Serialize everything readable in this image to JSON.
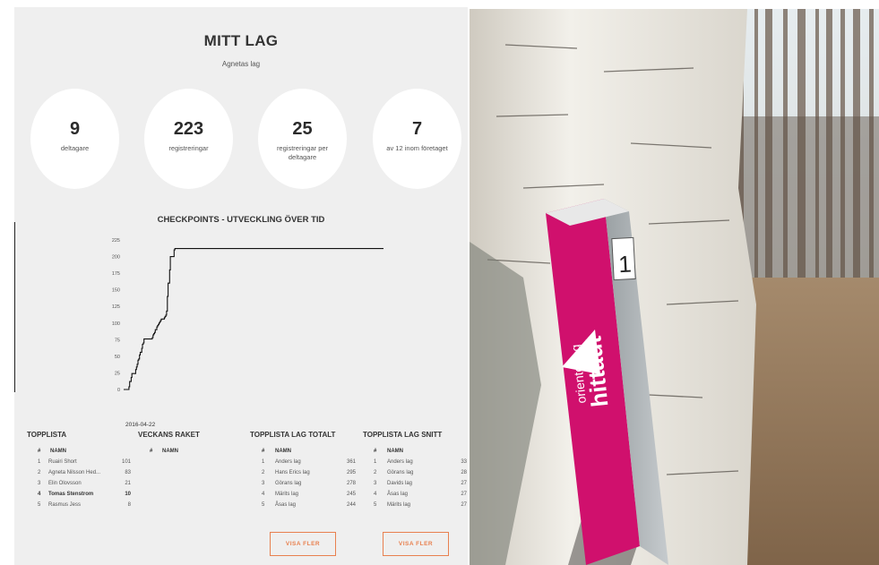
{
  "header": {
    "title": "MITT LAG",
    "subtitle": "Agnetas lag"
  },
  "stats": [
    {
      "value": "9",
      "label": "deltagare"
    },
    {
      "value": "223",
      "label": "registreringar"
    },
    {
      "value": "25",
      "label": "registreringar per deltagare"
    },
    {
      "value": "7",
      "label": "av 12 inom företaget"
    }
  ],
  "chart_data": {
    "type": "line",
    "title": "CHECKPOINTS - UTVECKLING ÖVER TID",
    "ylim": [
      0,
      225
    ],
    "yticks": [
      0,
      25,
      50,
      75,
      100,
      125,
      150,
      175,
      200,
      225
    ],
    "x_label_first": "2016-04-22",
    "values": [
      0,
      0,
      0,
      0,
      0,
      0,
      0,
      4,
      12,
      12,
      18,
      24,
      24,
      24,
      24,
      24,
      30,
      34,
      38,
      44,
      46,
      52,
      56,
      56,
      62,
      68,
      70,
      76,
      76,
      76,
      76,
      76,
      76,
      76,
      76,
      76,
      76,
      76,
      78,
      82,
      84,
      86,
      90,
      90,
      94,
      96,
      98,
      100,
      102,
      104,
      106,
      106,
      106,
      106,
      108,
      110,
      112,
      118,
      140,
      160,
      160,
      180,
      200,
      200,
      200,
      200,
      200,
      210,
      212,
      212,
      212,
      212,
      212,
      212,
      212,
      212,
      212,
      212,
      212,
      212,
      212,
      212,
      212,
      212,
      212,
      212,
      212,
      212,
      212,
      212,
      212,
      212,
      212,
      212,
      212,
      212,
      212,
      212,
      212,
      212,
      212,
      212,
      212,
      212,
      212,
      212,
      212,
      212,
      212,
      212,
      212,
      212,
      212,
      212,
      212,
      212,
      212,
      212,
      212,
      212,
      212,
      212,
      212,
      212,
      212,
      212,
      212,
      212,
      212,
      212,
      212,
      212,
      212,
      212,
      212,
      212,
      212,
      212,
      212,
      212,
      212,
      212,
      212,
      212,
      212,
      212,
      212,
      212,
      212,
      212,
      212,
      212,
      212,
      212,
      212,
      212,
      212,
      212,
      212,
      212,
      212,
      212,
      212,
      212,
      212,
      212,
      212,
      212,
      212,
      212,
      212,
      212,
      212,
      212,
      212,
      212,
      212,
      212,
      212,
      212,
      212,
      212,
      212,
      212,
      212,
      212,
      212,
      212,
      212,
      212,
      212,
      212,
      212,
      212,
      212,
      212,
      212,
      212,
      212,
      212,
      212,
      212,
      212,
      212,
      212,
      212,
      212,
      212,
      212,
      212,
      212,
      212,
      212,
      212,
      212,
      212,
      212,
      212,
      212,
      212,
      212,
      212,
      212,
      212,
      212,
      212,
      212,
      212,
      212,
      212,
      212,
      212,
      212,
      212,
      212,
      212,
      212,
      212,
      212,
      212,
      212,
      212,
      212,
      212,
      212,
      212,
      212,
      212,
      212,
      212,
      212,
      212,
      212,
      212,
      212,
      212,
      212,
      212,
      212,
      212,
      212,
      212,
      212,
      212,
      212,
      212,
      212,
      212,
      212,
      212,
      212,
      212,
      212,
      212,
      212,
      212,
      212,
      212,
      212,
      212,
      212,
      212,
      212,
      212,
      212,
      212,
      212,
      212,
      212,
      212,
      212,
      212,
      212,
      212,
      212,
      212,
      212,
      212,
      212,
      212,
      212,
      212,
      212,
      212,
      212,
      212,
      212,
      212,
      212,
      212,
      212,
      212,
      212,
      212,
      212,
      212,
      212,
      212,
      212,
      212,
      212,
      212,
      212,
      212,
      212,
      212,
      212,
      212,
      212,
      212,
      212,
      212,
      212,
      212,
      212,
      212,
      212,
      212,
      212,
      212,
      212,
      212,
      212,
      212,
      212,
      212
    ]
  },
  "topplista": {
    "title": "TOPPLISTA",
    "col_num": "#",
    "col_name": "NAMN",
    "rows": [
      {
        "rank": "1",
        "name": "Ruairi Short",
        "value": "101"
      },
      {
        "rank": "2",
        "name": "Agneta Nilsson Hed...",
        "value": "83"
      },
      {
        "rank": "3",
        "name": "Elin Olovsson",
        "value": "21"
      },
      {
        "rank": "4",
        "name": "Tomas Stenstrom",
        "value": "10"
      },
      {
        "rank": "5",
        "name": "Rasmus Jess",
        "value": "8"
      }
    ]
  },
  "veckans": {
    "title": "VECKANS RAKET",
    "col_num": "#",
    "col_name": "NAMN"
  },
  "lag_totalt": {
    "title": "TOPPLISTA LAG TOTALT",
    "col_num": "#",
    "col_name": "NAMN",
    "rows": [
      {
        "rank": "1",
        "name": "Anders lag",
        "value": "361"
      },
      {
        "rank": "2",
        "name": "Hans Erics lag",
        "value": "295"
      },
      {
        "rank": "3",
        "name": "Görans lag",
        "value": "278"
      },
      {
        "rank": "4",
        "name": "Märits lag",
        "value": "245"
      },
      {
        "rank": "5",
        "name": "Åsas lag",
        "value": "244"
      }
    ],
    "button": "VISA FLER"
  },
  "lag_snitt": {
    "title": "TOPPLISTA LAG SNITT",
    "col_num": "#",
    "col_name": "NAMN",
    "rows": [
      {
        "rank": "1",
        "name": "Anders lag",
        "value": "33"
      },
      {
        "rank": "2",
        "name": "Görans lag",
        "value": "28"
      },
      {
        "rank": "3",
        "name": "Davids lag",
        "value": "27"
      },
      {
        "rank": "4",
        "name": "Åsas lag",
        "value": "27"
      },
      {
        "rank": "5",
        "name": "Märits lag",
        "value": "27"
      }
    ],
    "button": "VISA FLER"
  },
  "photo": {
    "post_number": "1",
    "post_text_small": "orientering",
    "post_text_large": "hittaut",
    "colors": {
      "post": "#d0106d",
      "birch": "#e9e6de",
      "sky": "#dfe6ea",
      "ground": "#9c8062"
    }
  }
}
